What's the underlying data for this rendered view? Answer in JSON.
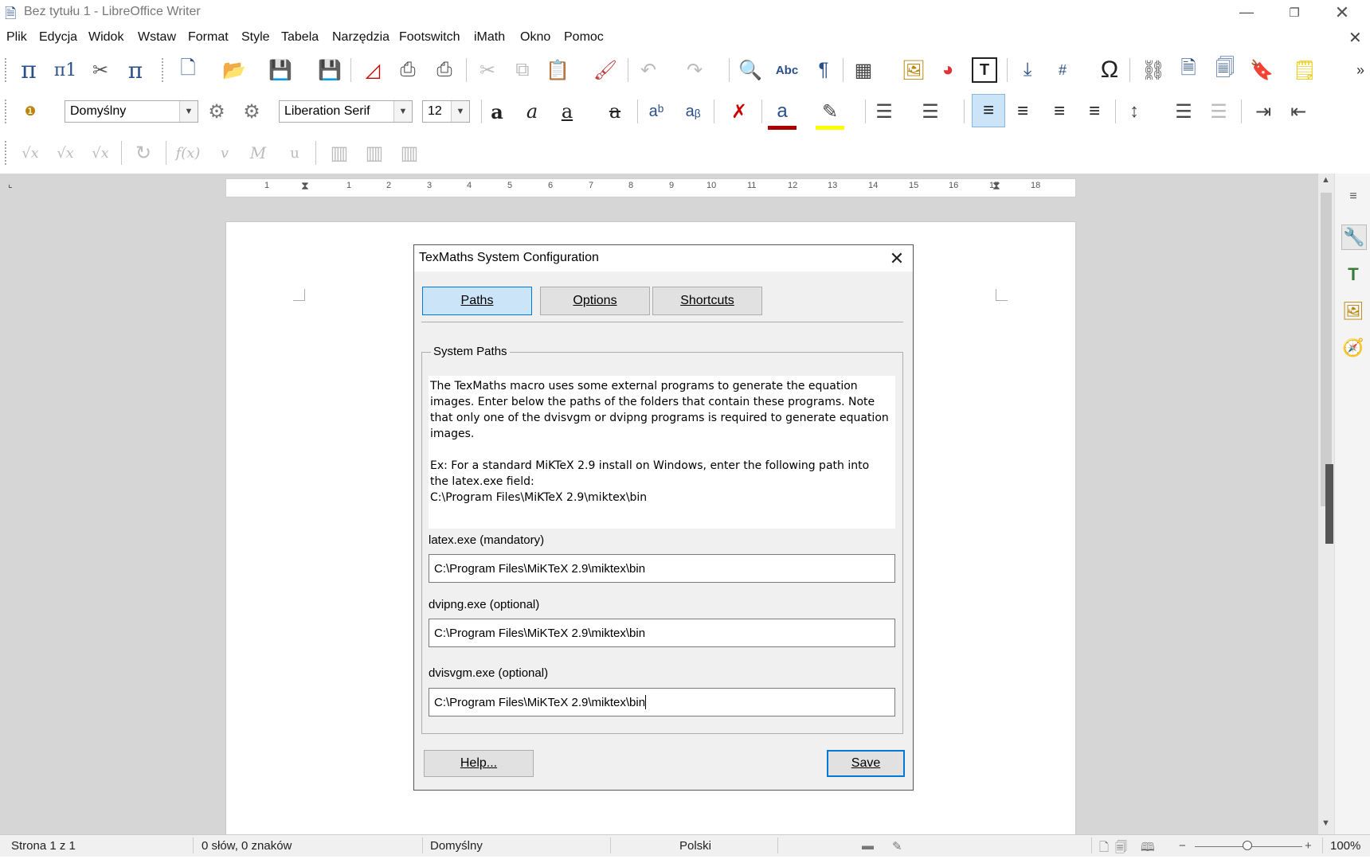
{
  "window": {
    "title": "Bez tytułu 1 - LibreOffice Writer"
  },
  "menu": [
    "Plik",
    "Edycja",
    "Widok",
    "Wstaw",
    "Format",
    "Style",
    "Tabela",
    "Narzędzia",
    "Footswitch",
    "iMath",
    "Okno",
    "Pomoc"
  ],
  "formatting": {
    "paragraph_style": "Domyślny",
    "font_name": "Liberation Serif",
    "font_size": "12"
  },
  "ruler": {
    "numbers": [
      "1",
      "1",
      "2",
      "3",
      "4",
      "5",
      "6",
      "7",
      "8",
      "9",
      "10",
      "11",
      "12",
      "13",
      "14",
      "15",
      "16",
      "17",
      "18"
    ]
  },
  "status": {
    "page": "Strona 1 z 1",
    "words": "0 słów, 0 znaków",
    "style": "Domyślny",
    "language": "Polski",
    "zoom": "100%"
  },
  "dialog": {
    "title": "TexMaths System Configuration",
    "tabs": [
      "Paths",
      "Options",
      "Shortcuts"
    ],
    "active_tab": "Paths",
    "group_label": "System Paths",
    "description": [
      "The TexMaths macro uses some external programs to generate the equation",
      "images. Enter below the paths of the folders that contain these programs. Note",
      "that only one of the dvisvgm or dvipng programs is required to generate equation",
      "images.",
      "",
      "Ex: For a standard MiKTeX 2.9 install on Windows, enter the following path into",
      "the latex.exe field:",
      "C:\\Program Files\\MiKTeX 2.9\\miktex\\bin"
    ],
    "fields": [
      {
        "label": "latex.exe (mandatory)",
        "value": "C:\\Program Files\\MiKTeX 2.9\\miktex\\bin"
      },
      {
        "label": "dvipng.exe (optional)",
        "value": "C:\\Program Files\\MiKTeX 2.9\\miktex\\bin"
      },
      {
        "label": "dvisvgm.exe (optional)",
        "value": "C:\\Program Files\\MiKTeX 2.9\\miktex\\bin"
      }
    ],
    "help_label": "Help...",
    "save_label": "Save"
  },
  "colors": {
    "accent": "#0078d7",
    "tab_active_bg": "#cce4f7",
    "workspace": "#d6d6d6"
  }
}
